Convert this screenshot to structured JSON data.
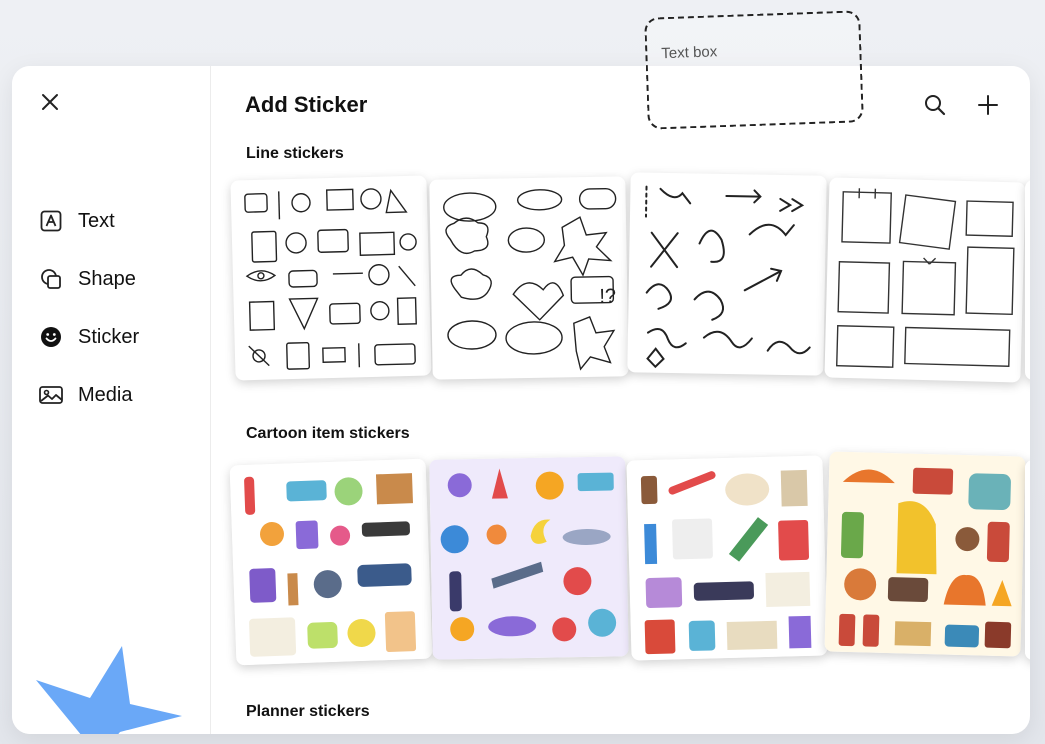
{
  "canvas": {
    "text_box_label": "Text box"
  },
  "sidebar": {
    "close_icon": "close-icon",
    "items": [
      {
        "label": "Text",
        "icon": "text-icon"
      },
      {
        "label": "Shape",
        "icon": "shape-icon"
      },
      {
        "label": "Sticker",
        "icon": "sticker-icon"
      },
      {
        "label": "Media",
        "icon": "media-icon"
      }
    ]
  },
  "header": {
    "title": "Add Sticker",
    "search_icon": "search-icon",
    "add_icon": "plus-icon"
  },
  "sections": [
    {
      "title": "Line stickers"
    },
    {
      "title": "Cartoon item stickers"
    },
    {
      "title": "Planner stickers"
    }
  ],
  "colors": {
    "accent_star": "#6aa8f7",
    "panel_bg": "#ffffff",
    "space_sheet_bg": "#efeafb",
    "autumn_sheet_bg": "#fff8e6"
  }
}
